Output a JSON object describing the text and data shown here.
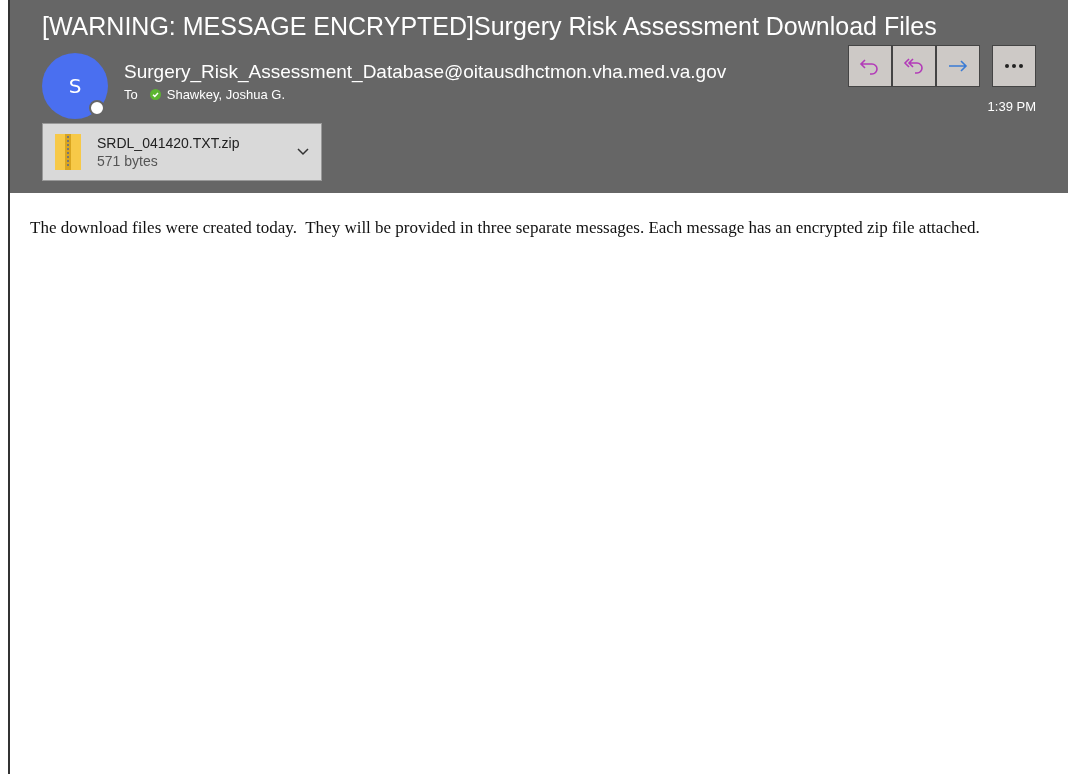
{
  "subject": "[WARNING: MESSAGE ENCRYPTED]Surgery Risk Assessment Download Files",
  "sender": {
    "initial": "S",
    "address": "Surgery_Risk_Assessment_Database@oitausdhctmon.vha.med.va.gov"
  },
  "to": {
    "label": "To",
    "name": "Shawkey, Joshua G."
  },
  "time": "1:39 PM",
  "attachment": {
    "name": "SRDL_041420.TXT.zip",
    "size": "571 bytes"
  },
  "body": "The download files were created today.  They will be provided in three separate messages. Each message has an encrypted zip file attached."
}
